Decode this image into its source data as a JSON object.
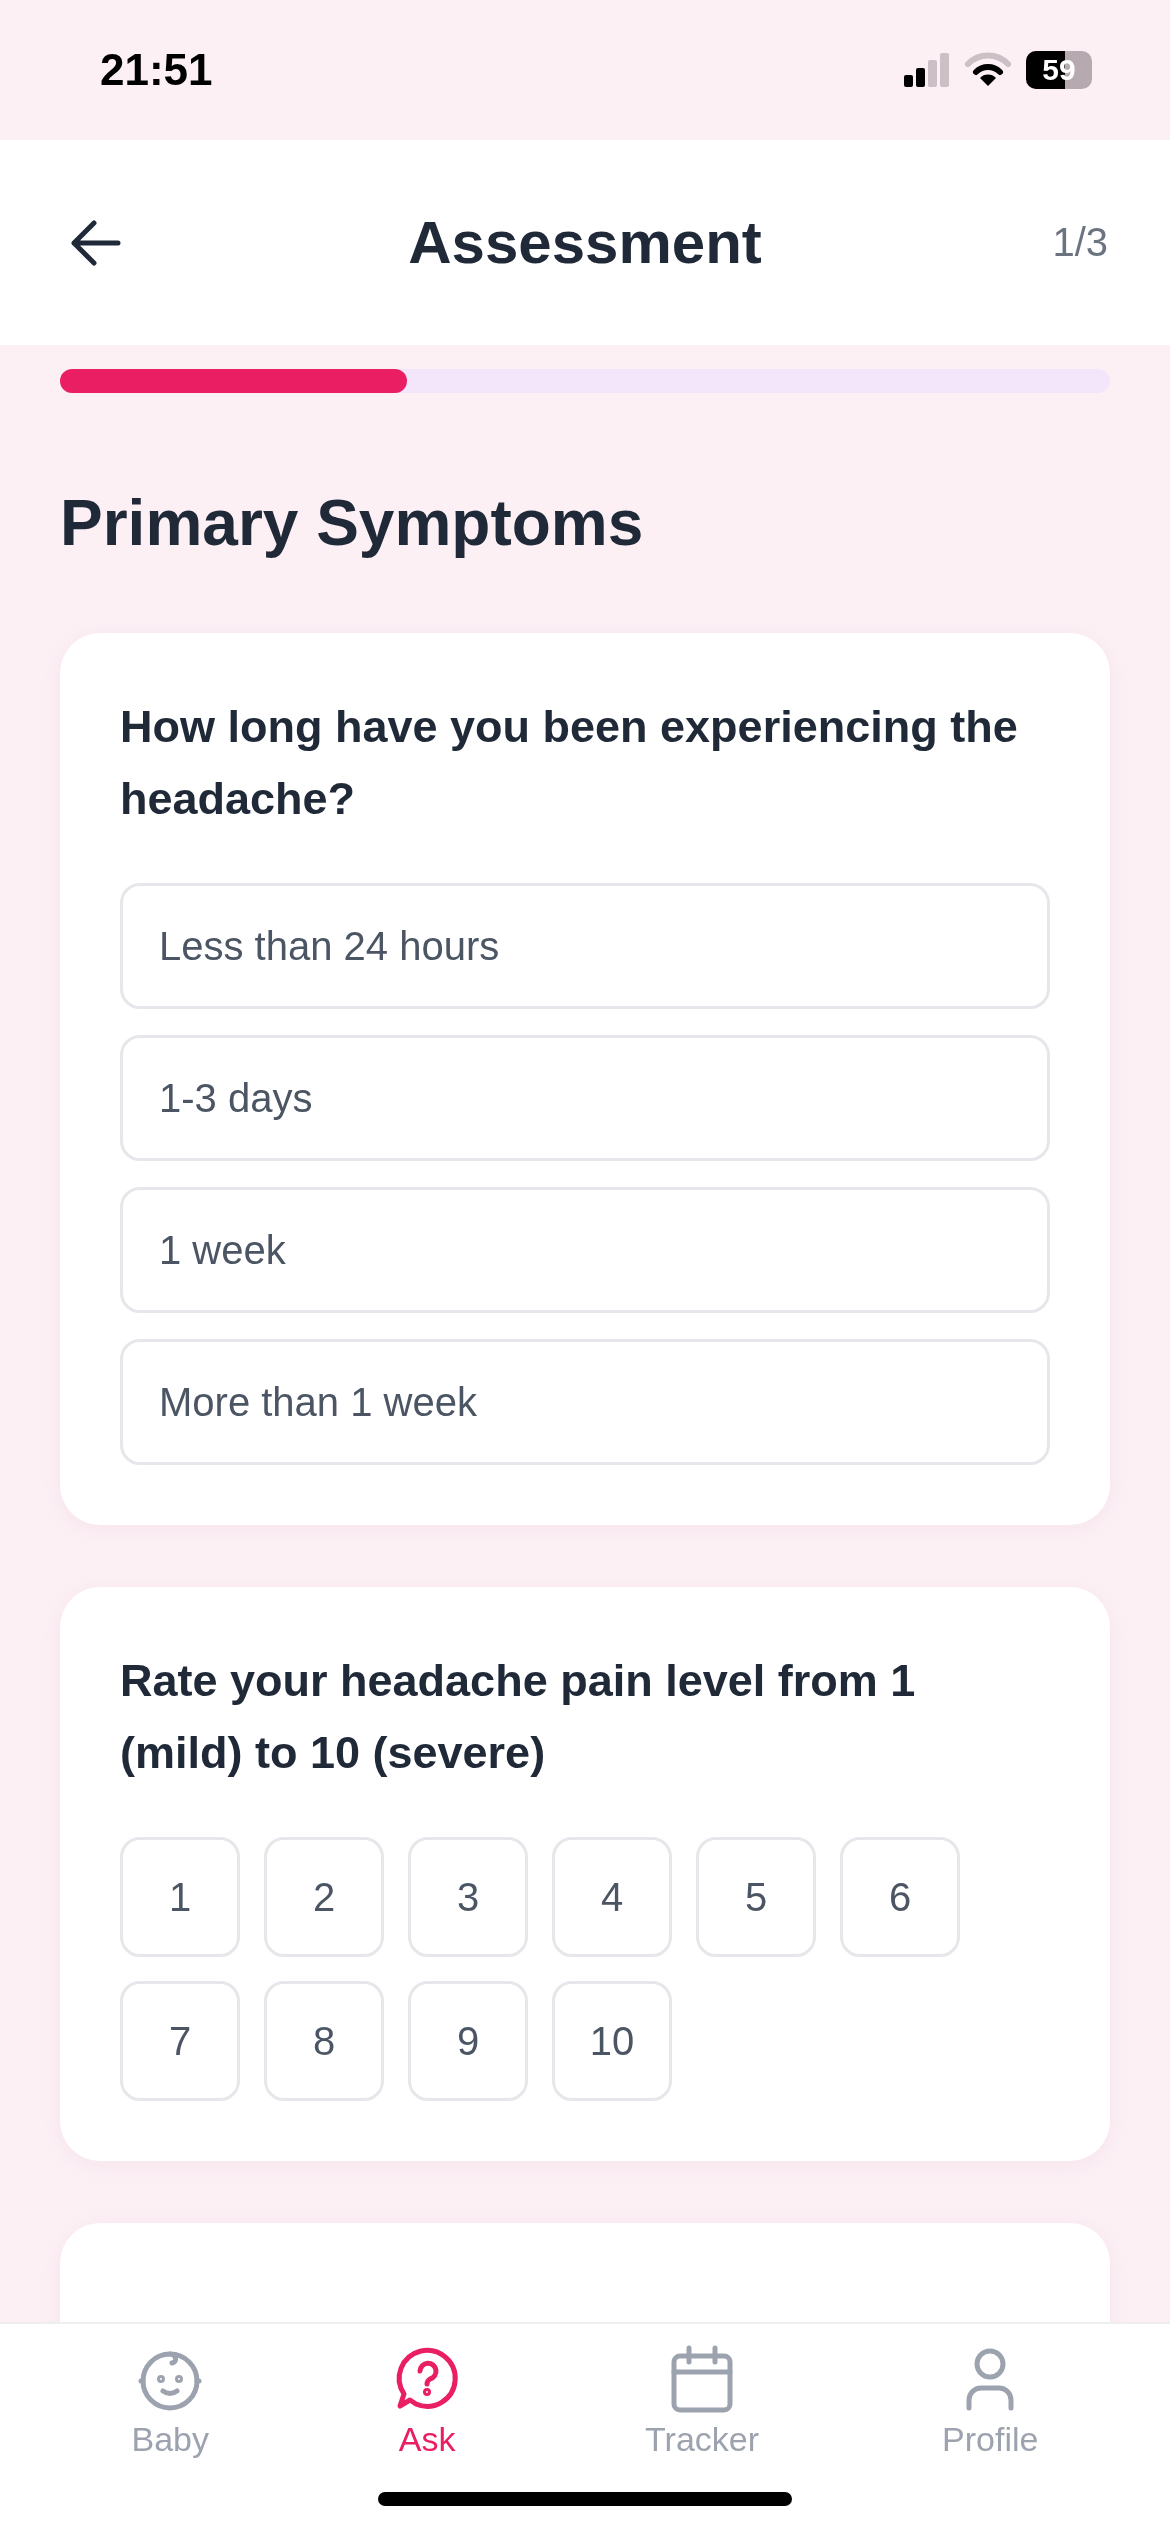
{
  "status_bar": {
    "time": "21:51",
    "battery": "59"
  },
  "header": {
    "title": "Assessment",
    "step": "1/3"
  },
  "progress": {
    "level": 0.33
  },
  "section_title": "Primary Symptoms",
  "questions": [
    {
      "kind": "list",
      "text": "How long have you been experiencing the headache?",
      "options": [
        {
          "label": "Less than 24 hours",
          "selected": false
        },
        {
          "label": "1-3 days",
          "selected": false
        },
        {
          "label": "1 week",
          "selected": false
        },
        {
          "label": "More than 1 week",
          "selected": false
        }
      ]
    },
    {
      "kind": "grid",
      "text": "Rate your headache pain level from 1 (mild) to 10 (severe)",
      "options": [
        {
          "label": "1",
          "selected": false
        },
        {
          "label": "2",
          "selected": false
        },
        {
          "label": "3",
          "selected": false
        },
        {
          "label": "4",
          "selected": false
        },
        {
          "label": "5",
          "selected": false
        },
        {
          "label": "6",
          "selected": false
        },
        {
          "label": "7",
          "selected": false
        },
        {
          "label": "8",
          "selected": false
        },
        {
          "label": "9",
          "selected": false
        },
        {
          "label": "10",
          "selected": false
        }
      ]
    }
  ],
  "tabs": [
    {
      "kind": "baby",
      "label": "Baby",
      "selected": false
    },
    {
      "kind": "ask",
      "label": "Ask",
      "selected": true
    },
    {
      "kind": "tracker",
      "label": "Tracker",
      "selected": false
    },
    {
      "kind": "profile",
      "label": "Profile",
      "selected": false
    }
  ]
}
